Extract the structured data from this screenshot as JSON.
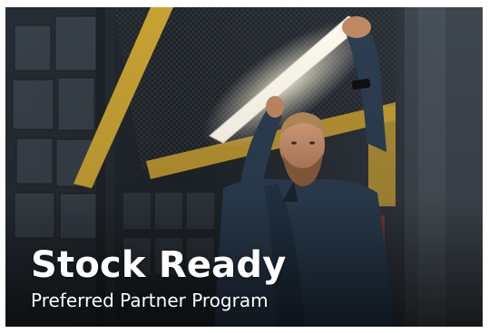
{
  "banner": {
    "title": "Stock Ready",
    "subtitle": "Preferred Partner Program",
    "image": "warehouse worker reaching up to overhead light between shelving racks",
    "colors": {
      "background": "#11151a",
      "text": "#ffffff",
      "beam_yellow": "#c9a233",
      "shirt": "#2c3e52"
    }
  }
}
